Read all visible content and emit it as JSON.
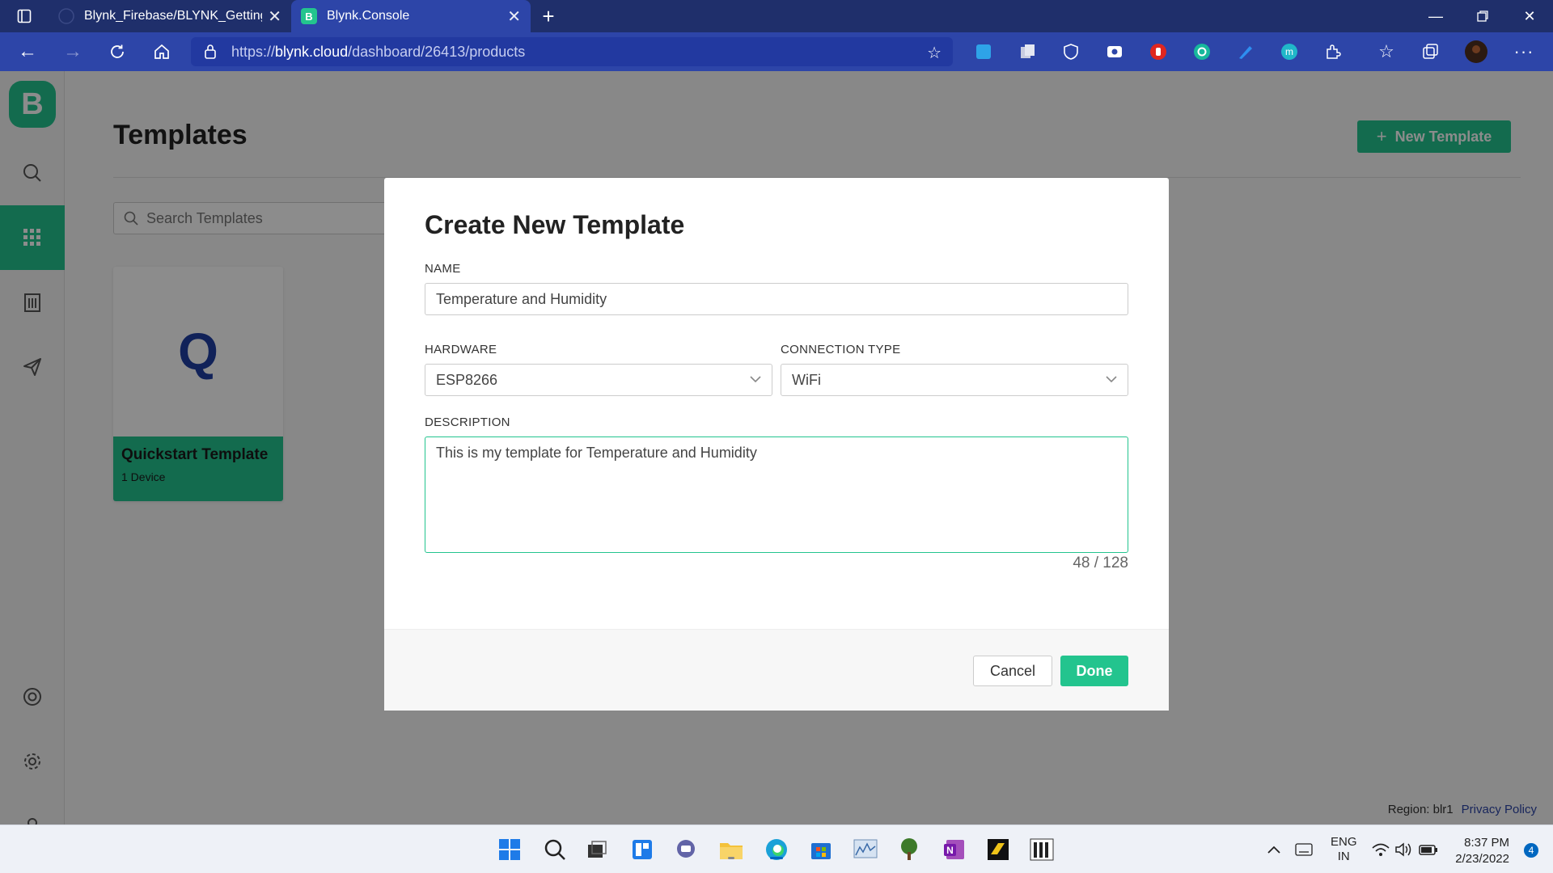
{
  "browser": {
    "tabs": [
      {
        "title": "Blynk_Firebase/BLYNK_Getting_S",
        "active": false
      },
      {
        "title": "Blynk.Console",
        "active": true
      }
    ],
    "url_prefix": "https://",
    "url_host": "blynk.cloud",
    "url_path": "/dashboard/26413/products",
    "profile_icon": "profile-avatar"
  },
  "app": {
    "logo_letter": "B",
    "sidebar": [
      "search-icon",
      "templates-grid-icon",
      "building-icon",
      "send-icon",
      "support-icon",
      "settings-icon",
      "user-icon"
    ],
    "page_title": "Templates",
    "new_template_label": "New Template",
    "search_placeholder": "Search Templates",
    "template_card": {
      "letter": "Q",
      "name": "Quickstart Template",
      "devices": "1 Device"
    },
    "footer": {
      "region": "Region: blr1",
      "privacy": "Privacy Policy"
    }
  },
  "modal": {
    "title": "Create New Template",
    "name_label": "NAME",
    "name_value": "Temperature and Humidity",
    "hardware_label": "HARDWARE",
    "hardware_value": "ESP8266",
    "connection_label": "CONNECTION TYPE",
    "connection_value": "WiFi",
    "description_label": "DESCRIPTION",
    "description_value": "This is my template for Temperature and Humidity",
    "counter": "48 / 128",
    "cancel_label": "Cancel",
    "done_label": "Done"
  },
  "taskbar": {
    "language": "ENG",
    "region": "IN",
    "time": "8:37 PM",
    "date": "2/23/2022",
    "notifications": "4"
  },
  "colors": {
    "accent": "#23c48e",
    "browser_bar": "#2d45a8",
    "tab_strip": "#1f2f6b"
  }
}
